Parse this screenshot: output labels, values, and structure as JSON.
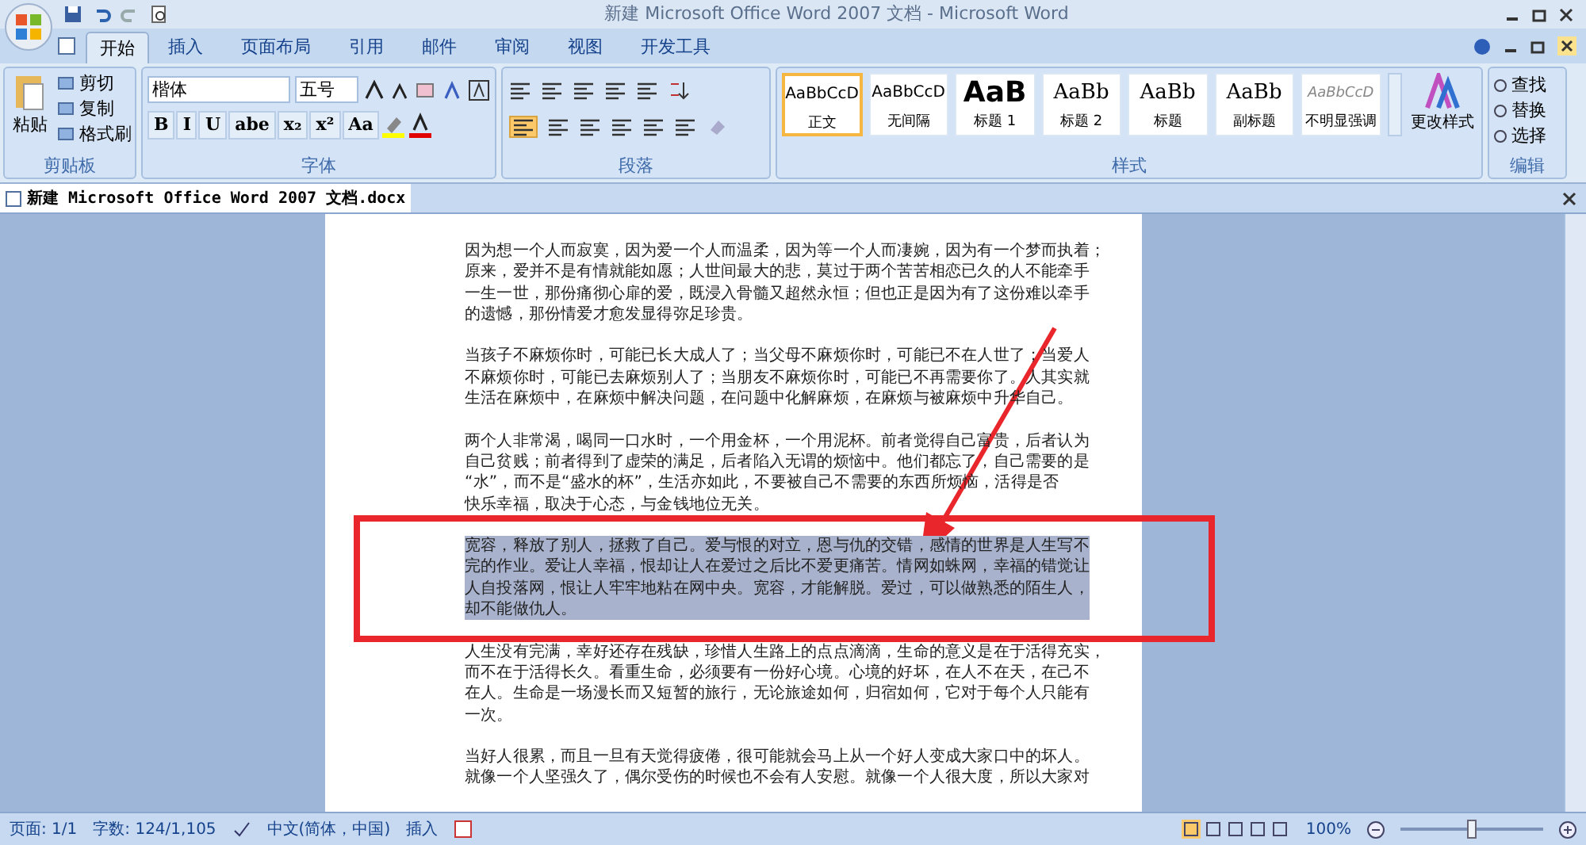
{
  "window": {
    "title": "新建 Microsoft Office Word 2007 文档 - Microsoft Word"
  },
  "tabs": [
    {
      "label": "开始",
      "selected": true
    },
    {
      "label": "插入",
      "selected": false
    },
    {
      "label": "页面布局",
      "selected": false
    },
    {
      "label": "引用",
      "selected": false
    },
    {
      "label": "邮件",
      "selected": false
    },
    {
      "label": "审阅",
      "selected": false
    },
    {
      "label": "视图",
      "selected": false
    },
    {
      "label": "开发工具",
      "selected": false
    }
  ],
  "clipboard": {
    "paste": "粘贴",
    "items": [
      "剪切",
      "复制",
      "格式刷"
    ],
    "label": "剪贴板"
  },
  "font": {
    "font_name": "楷体",
    "font_size": "五号",
    "format_buttons": [
      "B",
      "I",
      "U",
      "abe",
      "x₂",
      "x²",
      "Aa"
    ],
    "label": "字体"
  },
  "paragraph": {
    "label": "段落"
  },
  "styles": {
    "items": [
      {
        "preview": "AaBbCcD",
        "label": "正文",
        "kind": "body",
        "selected": true
      },
      {
        "preview": "AaBbCcD",
        "label": "无间隔",
        "kind": "body",
        "selected": false
      },
      {
        "preview": "AaB",
        "label": "标题 1",
        "kind": "heading",
        "selected": false
      },
      {
        "preview": "AaBb",
        "label": "标题 2",
        "kind": "serif",
        "selected": false
      },
      {
        "preview": "AaBb",
        "label": "标题",
        "kind": "serif",
        "selected": false
      },
      {
        "preview": "AaBb",
        "label": "副标题",
        "kind": "serif",
        "selected": false
      },
      {
        "preview": "AaBbCcD",
        "label": "不明显强调",
        "kind": "emphasis",
        "selected": false
      }
    ],
    "change_styles": "更改样式",
    "label": "样式"
  },
  "editing": {
    "items": [
      "查找",
      "替换",
      "选择"
    ],
    "label": "编辑"
  },
  "document_tab": "新建 Microsoft Office Word 2007 文档.docx",
  "paragraphs": [
    {
      "lines": [
        "因为想一个人而寂寞，因为爱一个人而温柔，因为等一个人而凄婉，因为有一个梦而执着；",
        "原来，爱并不是有情就能如愿；人世间最大的悲，莫过于两个苦苦相恋已久的人不能牵手",
        "一生一世，那份痛彻心扉的爱，既浸入骨髓又超然永恒；但也正是因为有了这份难以牵手",
        "的遗憾，那份情爱才愈发显得弥足珍贵。"
      ],
      "selected": false
    },
    {
      "lines": [
        "当孩子不麻烦你时，可能已长大成人了；当父母不麻烦你时，可能已不在人世了；当爱人",
        "不麻烦你时，可能已去麻烦别人了；当朋友不麻烦你时，可能已不再需要你了。人其实就",
        "生活在麻烦中，在麻烦中解决问题，在问题中化解麻烦，在麻烦与被麻烦中升华自己。"
      ],
      "selected": false
    },
    {
      "lines": [
        "两个人非常渴，喝同一口水时，一个用金杯，一个用泥杯。前者觉得自己富贵，后者认为",
        "自己贫贱；前者得到了虚荣的满足，后者陷入无谓的烦恼中。他们都忘了，自己需要的是",
        "“水”，而不是“盛水的杯”，生活亦如此，不要被自己不需要的东西所烦恼，活得是否",
        "快乐幸福，取决于心态，与金钱地位无关。"
      ],
      "selected": false
    },
    {
      "lines": [
        "宽容，释放了别人，拯救了自己。爱与恨的对立，恩与仇的交错，感情的世界是人生写不",
        "完的作业。爱让人幸福，恨却让人在爱过之后比不爱更痛苦。情网如蛛网，幸福的错觉让",
        "人自投落网，恨让人牢牢地粘在网中央。宽容，才能解脱。爱过，可以做熟悉的陌生人，",
        "却不能做仇人。"
      ],
      "selected": true
    },
    {
      "lines": [
        "人生没有完满，幸好还存在残缺，珍惜人生路上的点点滴滴，生命的意义是在于活得充实，",
        "而不在于活得长久。看重生命，必须要有一份好心境。心境的好坏，在人不在天，在己不",
        "在人。生命是一场漫长而又短暂的旅行，无论旅途如何，归宿如何，它对于每个人只能有",
        "一次。"
      ],
      "selected": false
    },
    {
      "lines": [
        "当好人很累，而且一旦有天觉得疲倦，很可能就会马上从一个好人变成大家口中的坏人。",
        "就像一个人坚强久了，偶尔受伤的时候也不会有人安慰。就像一个人很大度，所以大家对"
      ],
      "selected": false
    }
  ],
  "status_bar": {
    "page": "页面: 1/1",
    "words": "字数: 124/1,105",
    "language": "中文(简体，中国)",
    "mode": "插入",
    "zoom": "100%",
    "zoom_level": {
      "level": 0.5
    }
  }
}
